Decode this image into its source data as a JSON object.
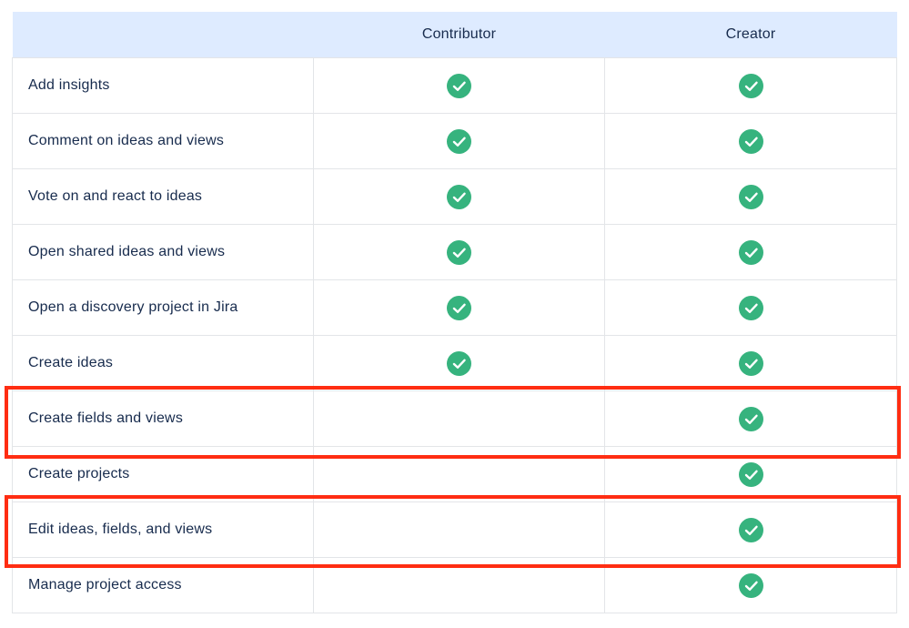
{
  "colors": {
    "header_bg": "#deebff",
    "check_green": "#36b37e",
    "highlight_red": "#ff2d12",
    "text": "#172b4d"
  },
  "table": {
    "headers": [
      "",
      "Contributor",
      "Creator"
    ],
    "rows": [
      {
        "feature": "Add insights",
        "contributor": true,
        "creator": true
      },
      {
        "feature": "Comment on ideas and views",
        "contributor": true,
        "creator": true
      },
      {
        "feature": "Vote on and react to ideas",
        "contributor": true,
        "creator": true
      },
      {
        "feature": "Open shared ideas and views",
        "contributor": true,
        "creator": true
      },
      {
        "feature": "Open a discovery project in Jira",
        "contributor": true,
        "creator": true
      },
      {
        "feature": "Create ideas",
        "contributor": true,
        "creator": true
      },
      {
        "feature": "Create fields and views",
        "contributor": false,
        "creator": true,
        "highlighted": true
      },
      {
        "feature": "Create projects",
        "contributor": false,
        "creator": true
      },
      {
        "feature": "Edit ideas, fields, and views",
        "contributor": false,
        "creator": true,
        "highlighted": true
      },
      {
        "feature": "Manage project access",
        "contributor": false,
        "creator": true
      }
    ]
  },
  "icons": {
    "check": "check-circle-icon"
  }
}
